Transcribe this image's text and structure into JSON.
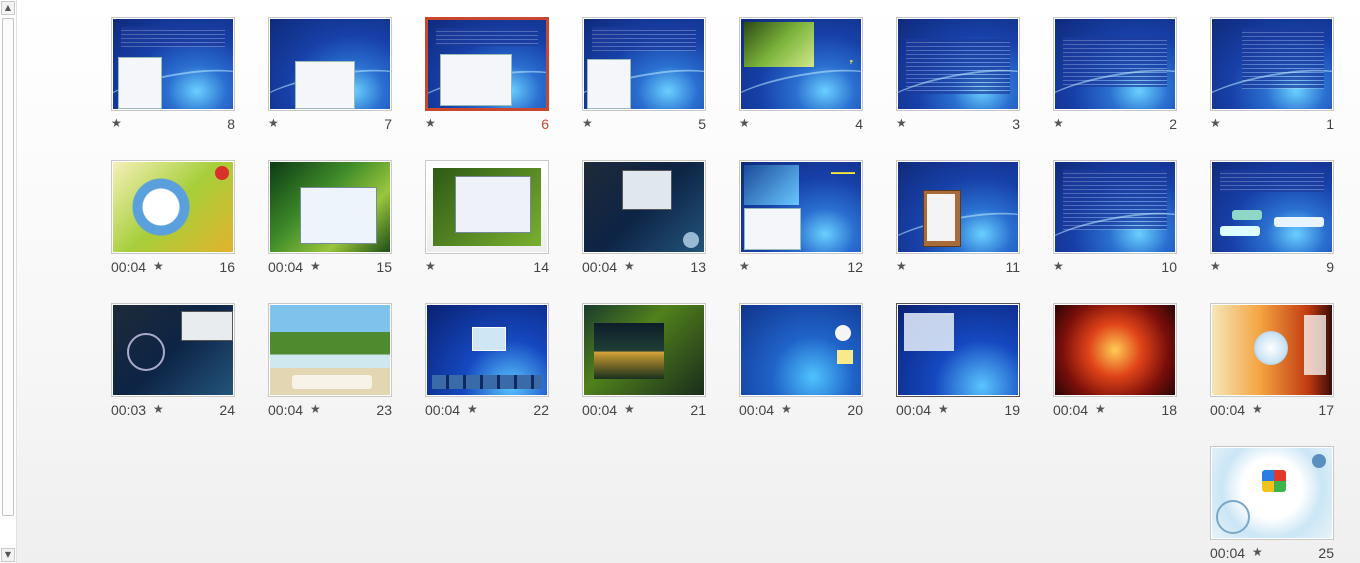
{
  "slides": [
    {
      "number": "8",
      "time": "",
      "star": "★"
    },
    {
      "number": "7",
      "time": "",
      "star": "★"
    },
    {
      "number": "6",
      "time": "",
      "star": "★"
    },
    {
      "number": "5",
      "time": "",
      "star": "★"
    },
    {
      "number": "4",
      "time": "",
      "star": "★"
    },
    {
      "number": "3",
      "time": "",
      "star": "★"
    },
    {
      "number": "2",
      "time": "",
      "star": "★"
    },
    {
      "number": "1",
      "time": "",
      "star": "★"
    },
    {
      "number": "16",
      "time": "00:04",
      "star": "★"
    },
    {
      "number": "15",
      "time": "00:04",
      "star": "★"
    },
    {
      "number": "14",
      "time": "",
      "star": "★"
    },
    {
      "number": "13",
      "time": "00:04",
      "star": "★"
    },
    {
      "number": "12",
      "time": "",
      "star": "★"
    },
    {
      "number": "11",
      "time": "",
      "star": "★"
    },
    {
      "number": "10",
      "time": "",
      "star": "★"
    },
    {
      "number": "9",
      "time": "",
      "star": "★"
    },
    {
      "number": "24",
      "time": "00:03",
      "star": "★"
    },
    {
      "number": "23",
      "time": "00:04",
      "star": "★"
    },
    {
      "number": "22",
      "time": "00:04",
      "star": "★"
    },
    {
      "number": "21",
      "time": "00:04",
      "star": "★"
    },
    {
      "number": "20",
      "time": "00:04",
      "star": "★"
    },
    {
      "number": "19",
      "time": "00:04",
      "star": "★"
    },
    {
      "number": "18",
      "time": "00:04",
      "star": "★"
    },
    {
      "number": "17",
      "time": "00:04",
      "star": "★"
    },
    {
      "number": "25",
      "time": "00:04",
      "star": "★"
    }
  ],
  "selected_slide": "6",
  "selection_color": "#c8472e",
  "scrollbar": {
    "up_icon": "▲",
    "down_icon": "▼"
  }
}
